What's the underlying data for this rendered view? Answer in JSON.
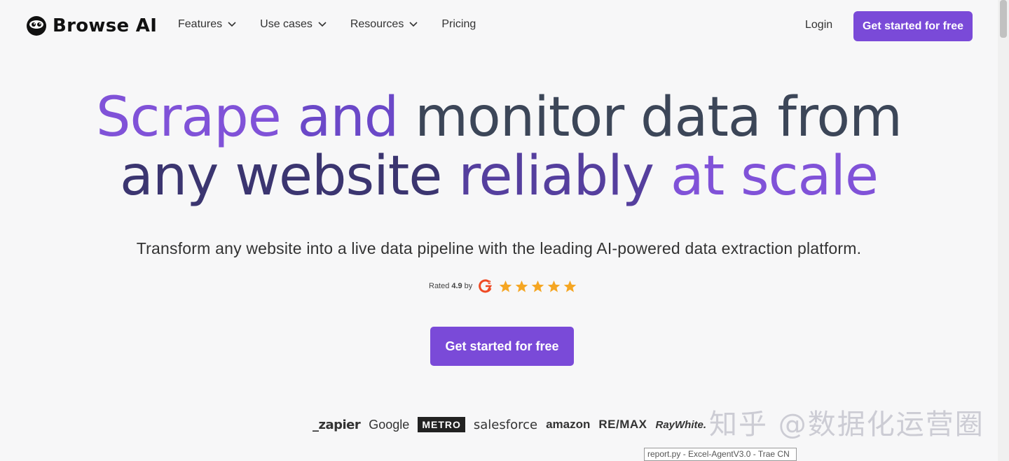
{
  "header": {
    "brand": "Browse AI",
    "nav": [
      {
        "label": "Features",
        "has_dropdown": true
      },
      {
        "label": "Use cases",
        "has_dropdown": true
      },
      {
        "label": "Resources",
        "has_dropdown": true
      },
      {
        "label": "Pricing",
        "has_dropdown": false
      }
    ],
    "login": "Login",
    "cta": "Get started for free"
  },
  "hero": {
    "headline_line1": {
      "w1": "Scrape",
      "w2": "and",
      "w3": "monitor data from"
    },
    "headline_line2": {
      "w1": "any website",
      "w2": "reliably",
      "w3": "at scale"
    },
    "subtitle": "Transform any website into a live data pipeline with the leading AI-powered data extraction platform.",
    "rating_prefix": "Rated",
    "rating_value": "4.9",
    "rating_suffix": "by",
    "stars": 5,
    "cta": "Get started for free"
  },
  "brands": [
    "_zapier",
    "Google",
    "METRO",
    "salesforce",
    "amazon",
    "RE/MAX",
    "RayWhite."
  ],
  "watermark": "知乎 @数据化运营圈",
  "tooltip": "report.py - Excel-AgentV3.0 - Trae CN",
  "colors": {
    "accent": "#7a4ad8",
    "star": "#f5a623",
    "g2": "#ef4a24"
  }
}
